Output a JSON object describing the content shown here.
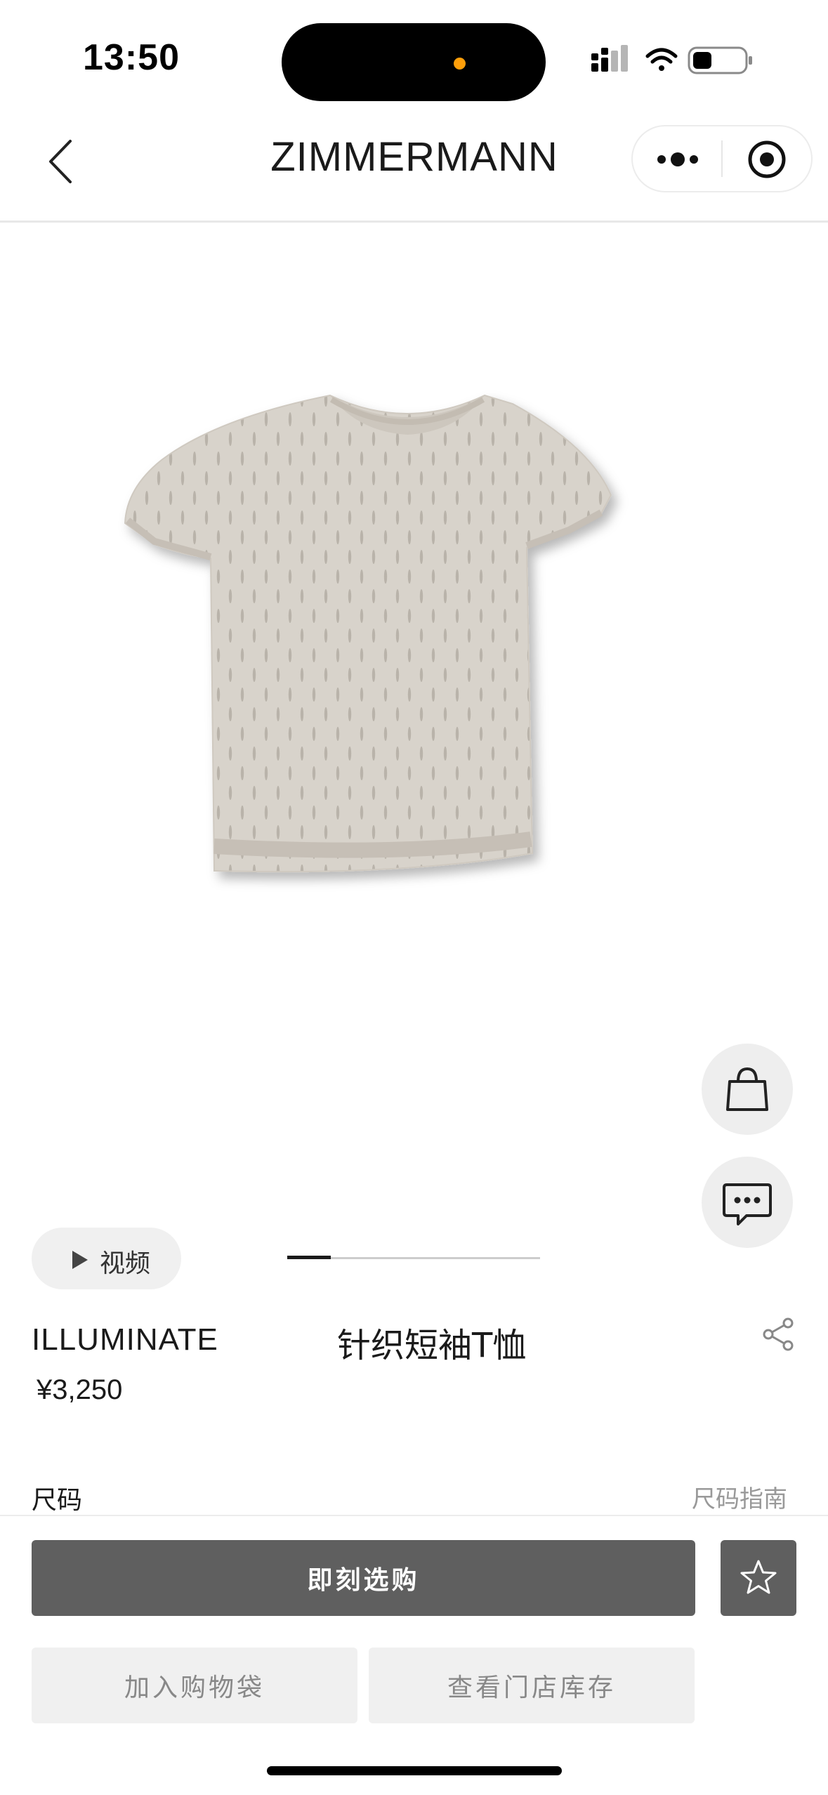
{
  "status_bar": {
    "time": "13:50"
  },
  "nav": {
    "title": "ZIMMERMANN"
  },
  "product": {
    "brand": "ILLUMINATE",
    "name": "针织短袖T恤",
    "price": "¥3,250",
    "image_color": "#d7d2ca",
    "image_current": 1
  },
  "video": {
    "label": "视频"
  },
  "size": {
    "label": "尺码",
    "guide": "尺码指南"
  },
  "actions": {
    "buy_now": "即刻选购",
    "add_to_bag": "加入购物袋",
    "check_stock": "查看门店库存"
  },
  "icons": {
    "back": "chevron-left-icon",
    "more": "more-dots-icon",
    "close_target": "target-icon",
    "bag": "shopping-bag-icon",
    "chat": "chat-icon",
    "play": "play-icon",
    "share": "share-icon",
    "favorite": "star-icon"
  }
}
